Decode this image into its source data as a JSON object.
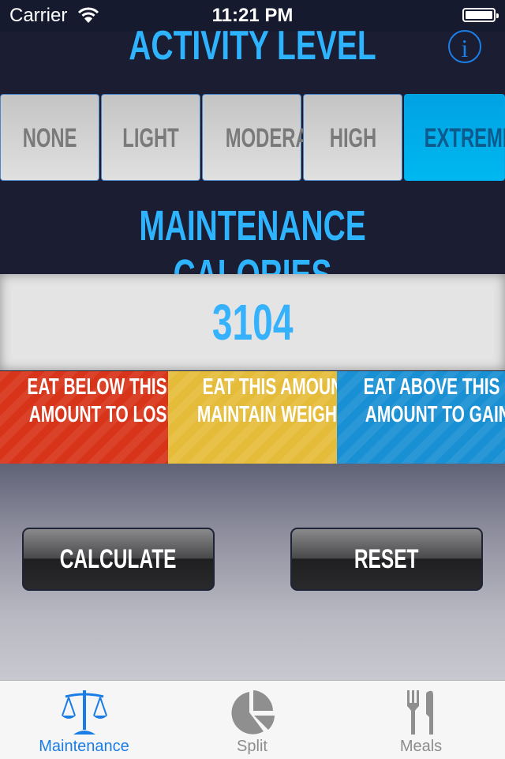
{
  "status_bar": {
    "carrier": "Carrier",
    "time": "11:21 PM",
    "wifi_icon": "wifi-icon",
    "battery_icon": "battery-icon"
  },
  "header": {
    "title": "ACTIVITY LEVEL",
    "info_icon": "info-icon",
    "info_glyph": "i"
  },
  "activity_levels": [
    {
      "label": "NONE",
      "selected": false
    },
    {
      "label": "LIGHT",
      "selected": false
    },
    {
      "label": "MODERATE",
      "selected": false
    },
    {
      "label": "HIGH",
      "selected": false
    },
    {
      "label": "EXTREME",
      "selected": true
    }
  ],
  "maintenance": {
    "title": "MAINTENANCE CALORIES",
    "value": "3104"
  },
  "advice": [
    {
      "line1": "EAT BELOW THIS",
      "line2": "AMOUNT TO LOSE",
      "color": "#d8341a"
    },
    {
      "line1": "EAT THIS AMOUNT TO",
      "line2": "MAINTAIN WEIGHT",
      "color": "#e5bc3a"
    },
    {
      "line1": "EAT ABOVE THIS",
      "line2": "AMOUNT TO GAIN",
      "color": "#1a90d4"
    }
  ],
  "buttons": {
    "calculate": "CALCULATE",
    "reset": "RESET"
  },
  "tab_bar": {
    "tabs": [
      {
        "label": "Maintenance",
        "icon": "scales-icon",
        "active": true
      },
      {
        "label": "Split",
        "icon": "pie-chart-icon",
        "active": false
      },
      {
        "label": "Meals",
        "icon": "fork-knife-icon",
        "active": false
      }
    ]
  },
  "colors": {
    "accent": "#2eb3ff",
    "selected": "#00b0ec",
    "tab_active": "#1a7de6",
    "background": "#1b1d33"
  }
}
